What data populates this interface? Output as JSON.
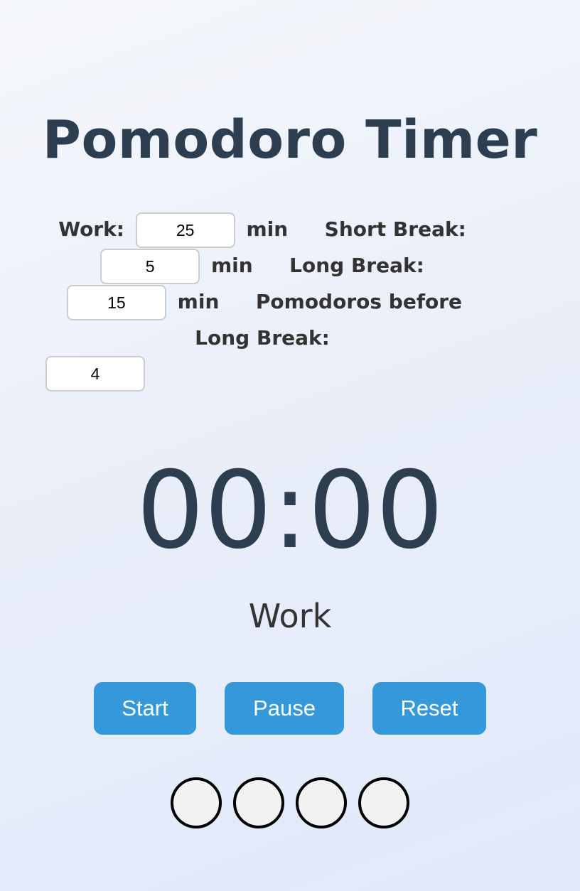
{
  "header": {
    "title": "Pomodoro Timer"
  },
  "settings": {
    "work_label": "Work:",
    "work_value": "25",
    "short_break_label": "Short Break:",
    "short_break_value": "5",
    "long_break_label": "Long Break:",
    "long_break_value": "15",
    "pomodoros_label": "Pomodoros before Long Break:",
    "pomodoros_value": "4",
    "unit": "min"
  },
  "timer": {
    "display": "00:00",
    "mode": "Work"
  },
  "controls": {
    "start_label": "Start",
    "pause_label": "Pause",
    "reset_label": "Reset"
  },
  "progress": {
    "completed": 0,
    "total": 4
  },
  "colors": {
    "accent": "#3498db",
    "title": "#2c3e50",
    "text": "#333333",
    "dot_fill": "#f2f2f2",
    "dot_border": "#000000"
  }
}
